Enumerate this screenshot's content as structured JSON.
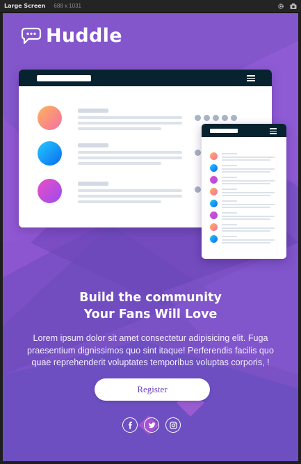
{
  "devtools": {
    "device_label": "Large Screen",
    "dimensions": "688 x 1031",
    "icons": [
      "gear-icon",
      "camera-icon"
    ]
  },
  "brand": {
    "name": "Huddle",
    "logo_icon": "chat-bubble-icon"
  },
  "hero": {
    "headline_line1": "Build the community",
    "headline_line2": "Your Fans Will Love",
    "body": "Lorem ipsum dolor sit amet consectetur adipisicing elit. Fuga praesentium dignissimos quo sint itaque! Perferendis facilis quo quae reprehenderit voluptates temporibus voluptas corporis, !",
    "cta_label": "Register"
  },
  "socials": [
    {
      "name": "facebook",
      "icon": "facebook-icon"
    },
    {
      "name": "twitter",
      "icon": "twitter-icon"
    },
    {
      "name": "instagram",
      "icon": "instagram-icon"
    }
  ],
  "colors": {
    "background": "#7a52c6",
    "text": "#ffffff",
    "accent": "#6b40b8",
    "mock_bar": "#06232f"
  }
}
